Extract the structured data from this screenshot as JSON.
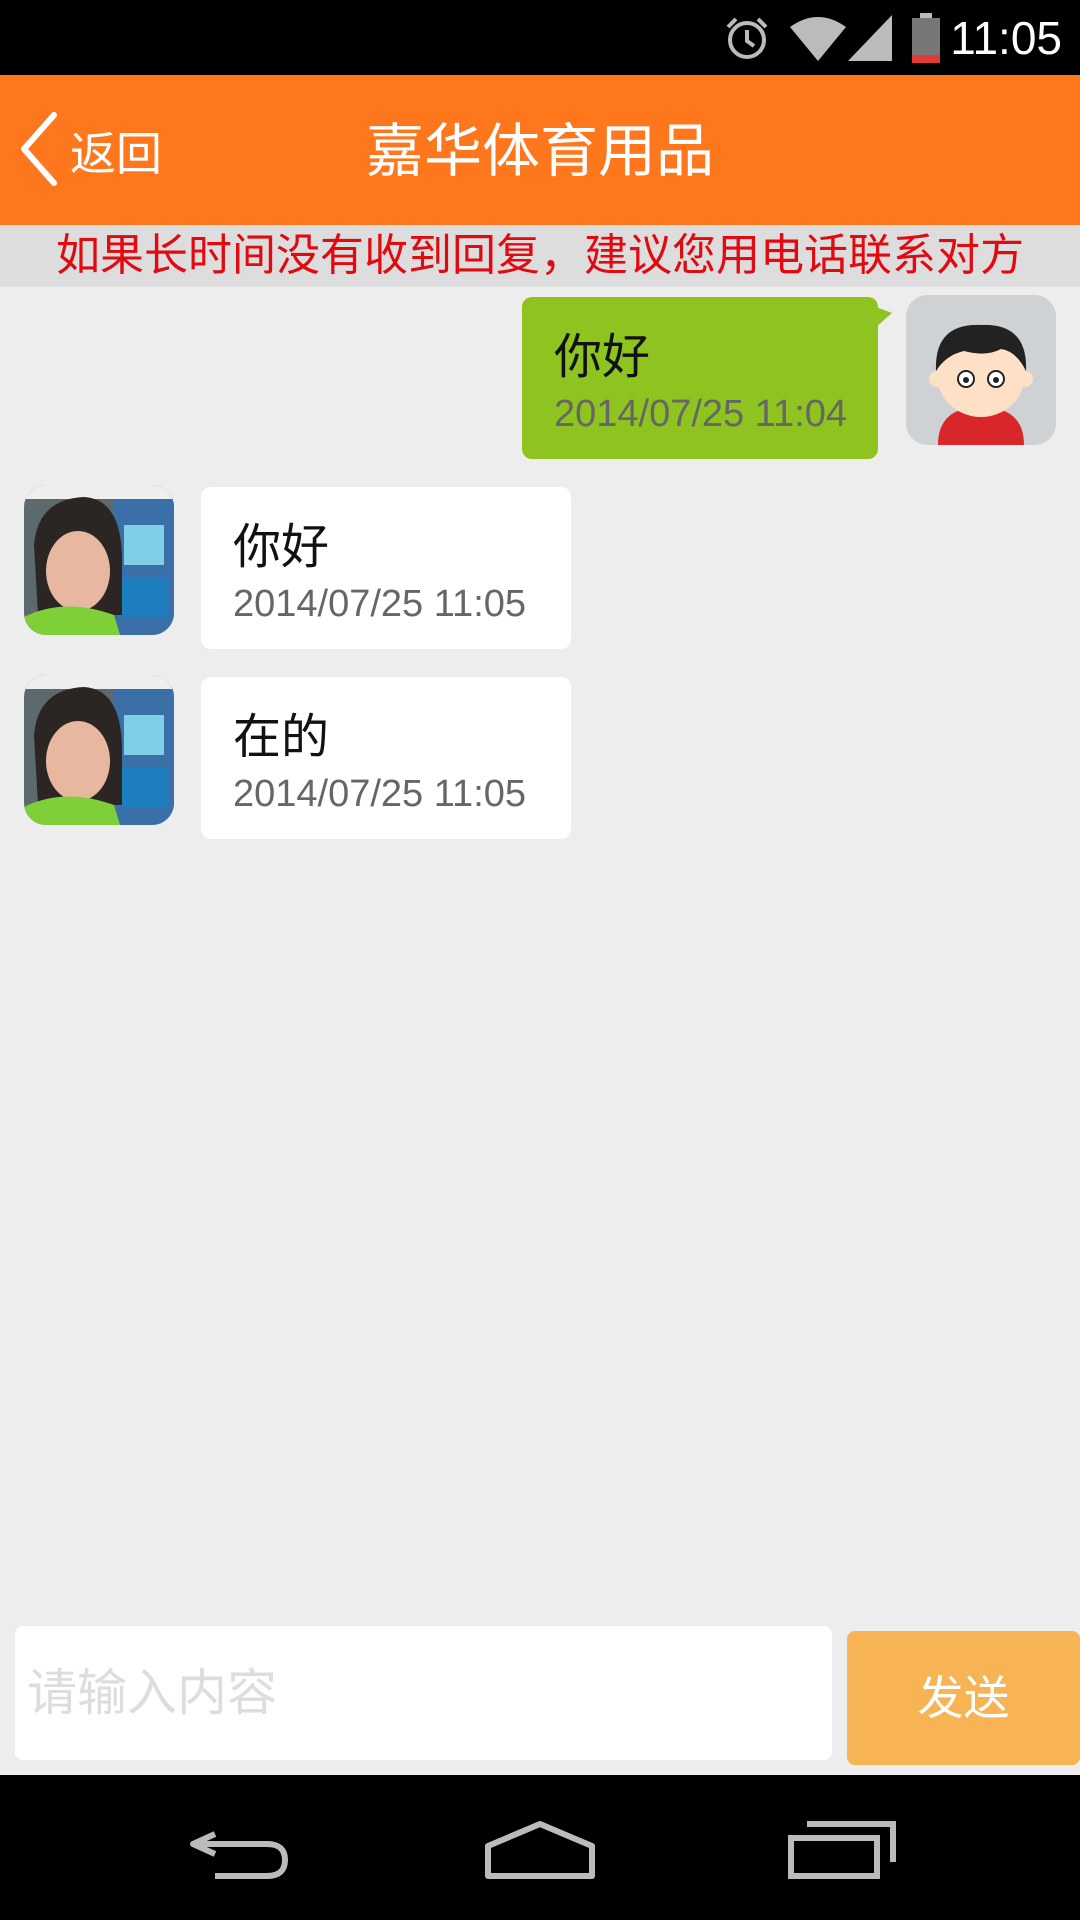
{
  "status_bar": {
    "time": "11:05",
    "icons": [
      "alarm-icon",
      "wifi-icon",
      "cell-signal-icon",
      "battery-icon"
    ],
    "battery_level": 0.1
  },
  "header": {
    "back_label": "返回",
    "title": "嘉华体育用品"
  },
  "notice": "如果长时间没有收到回复，建议您用电话联系对方",
  "messages": [
    {
      "sender": "me",
      "text": "你好",
      "time": "2014/07/25 11:04"
    },
    {
      "sender": "other",
      "text": "你好",
      "time": "2014/07/25 11:05"
    },
    {
      "sender": "other",
      "text": "在的",
      "time": "2014/07/25 11:05"
    }
  ],
  "input": {
    "placeholder": "请输入内容",
    "value": ""
  },
  "send_label": "发送",
  "nav": [
    "back-icon",
    "home-icon",
    "recents-icon"
  ],
  "colors": {
    "header": "#ff771d",
    "notice_text": "#e10a10",
    "my_bubble": "#8fc31f",
    "send_button": "#f8b355"
  }
}
